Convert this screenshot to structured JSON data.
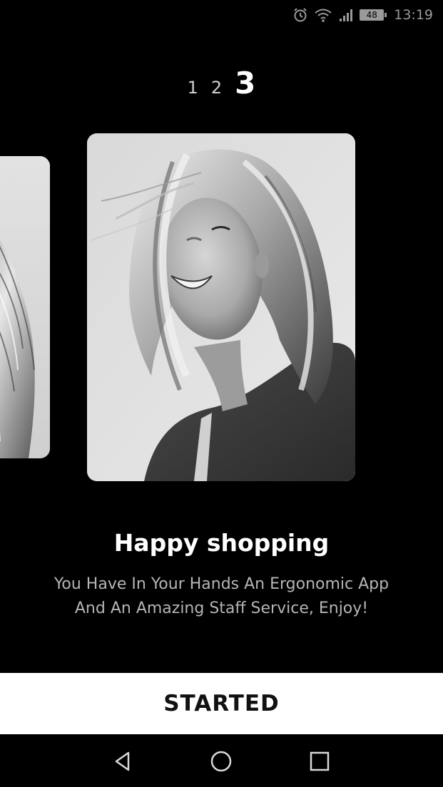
{
  "status_bar": {
    "battery": "48",
    "time": "13:19",
    "icons": [
      "alarm-icon",
      "wifi-icon",
      "signal-icon",
      "battery-icon"
    ]
  },
  "pager": {
    "pages": [
      "1",
      "2",
      "3"
    ],
    "active_index": 2
  },
  "slide": {
    "title": "Happy shopping",
    "description": "You Have In Your Hands An Ergonomic App And An Amazing Staff Service, Enjoy!"
  },
  "button": {
    "label": "STARTED"
  },
  "nav_bar": {
    "icons": [
      "back-icon",
      "home-icon",
      "recent-apps-icon"
    ]
  },
  "colors": {
    "background": "#000000",
    "button_background": "#ffffff",
    "title": "#ffffff",
    "description": "#b5b5b5"
  }
}
